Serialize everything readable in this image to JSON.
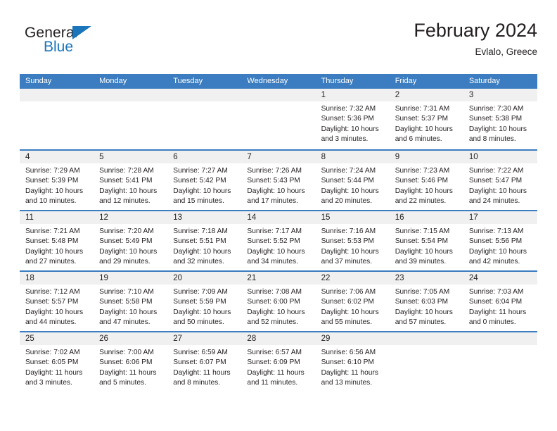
{
  "brand": {
    "general": "General",
    "blue": "Blue",
    "triangle_color": "#1b75bb"
  },
  "header": {
    "title": "February 2024",
    "subtitle": "Evlalo, Greece"
  },
  "theme": {
    "header_blue": "#3b7dc0",
    "daystrip_gray": "#f0f0f0",
    "text": "#231f20"
  },
  "weekdays": [
    "Sunday",
    "Monday",
    "Tuesday",
    "Wednesday",
    "Thursday",
    "Friday",
    "Saturday"
  ],
  "labels": {
    "sunrise": "Sunrise:",
    "sunset": "Sunset:",
    "daylight": "Daylight:"
  },
  "weeks": [
    [
      {
        "day": "",
        "empty": true
      },
      {
        "day": "",
        "empty": true
      },
      {
        "day": "",
        "empty": true
      },
      {
        "day": "",
        "empty": true
      },
      {
        "day": "1",
        "sunrise": "Sunrise: 7:32 AM",
        "sunset": "Sunset: 5:36 PM",
        "daylight1": "Daylight: 10 hours",
        "daylight2": "and 3 minutes."
      },
      {
        "day": "2",
        "sunrise": "Sunrise: 7:31 AM",
        "sunset": "Sunset: 5:37 PM",
        "daylight1": "Daylight: 10 hours",
        "daylight2": "and 6 minutes."
      },
      {
        "day": "3",
        "sunrise": "Sunrise: 7:30 AM",
        "sunset": "Sunset: 5:38 PM",
        "daylight1": "Daylight: 10 hours",
        "daylight2": "and 8 minutes."
      }
    ],
    [
      {
        "day": "4",
        "sunrise": "Sunrise: 7:29 AM",
        "sunset": "Sunset: 5:39 PM",
        "daylight1": "Daylight: 10 hours",
        "daylight2": "and 10 minutes."
      },
      {
        "day": "5",
        "sunrise": "Sunrise: 7:28 AM",
        "sunset": "Sunset: 5:41 PM",
        "daylight1": "Daylight: 10 hours",
        "daylight2": "and 12 minutes."
      },
      {
        "day": "6",
        "sunrise": "Sunrise: 7:27 AM",
        "sunset": "Sunset: 5:42 PM",
        "daylight1": "Daylight: 10 hours",
        "daylight2": "and 15 minutes."
      },
      {
        "day": "7",
        "sunrise": "Sunrise: 7:26 AM",
        "sunset": "Sunset: 5:43 PM",
        "daylight1": "Daylight: 10 hours",
        "daylight2": "and 17 minutes."
      },
      {
        "day": "8",
        "sunrise": "Sunrise: 7:24 AM",
        "sunset": "Sunset: 5:44 PM",
        "daylight1": "Daylight: 10 hours",
        "daylight2": "and 20 minutes."
      },
      {
        "day": "9",
        "sunrise": "Sunrise: 7:23 AM",
        "sunset": "Sunset: 5:46 PM",
        "daylight1": "Daylight: 10 hours",
        "daylight2": "and 22 minutes."
      },
      {
        "day": "10",
        "sunrise": "Sunrise: 7:22 AM",
        "sunset": "Sunset: 5:47 PM",
        "daylight1": "Daylight: 10 hours",
        "daylight2": "and 24 minutes."
      }
    ],
    [
      {
        "day": "11",
        "sunrise": "Sunrise: 7:21 AM",
        "sunset": "Sunset: 5:48 PM",
        "daylight1": "Daylight: 10 hours",
        "daylight2": "and 27 minutes."
      },
      {
        "day": "12",
        "sunrise": "Sunrise: 7:20 AM",
        "sunset": "Sunset: 5:49 PM",
        "daylight1": "Daylight: 10 hours",
        "daylight2": "and 29 minutes."
      },
      {
        "day": "13",
        "sunrise": "Sunrise: 7:18 AM",
        "sunset": "Sunset: 5:51 PM",
        "daylight1": "Daylight: 10 hours",
        "daylight2": "and 32 minutes."
      },
      {
        "day": "14",
        "sunrise": "Sunrise: 7:17 AM",
        "sunset": "Sunset: 5:52 PM",
        "daylight1": "Daylight: 10 hours",
        "daylight2": "and 34 minutes."
      },
      {
        "day": "15",
        "sunrise": "Sunrise: 7:16 AM",
        "sunset": "Sunset: 5:53 PM",
        "daylight1": "Daylight: 10 hours",
        "daylight2": "and 37 minutes."
      },
      {
        "day": "16",
        "sunrise": "Sunrise: 7:15 AM",
        "sunset": "Sunset: 5:54 PM",
        "daylight1": "Daylight: 10 hours",
        "daylight2": "and 39 minutes."
      },
      {
        "day": "17",
        "sunrise": "Sunrise: 7:13 AM",
        "sunset": "Sunset: 5:56 PM",
        "daylight1": "Daylight: 10 hours",
        "daylight2": "and 42 minutes."
      }
    ],
    [
      {
        "day": "18",
        "sunrise": "Sunrise: 7:12 AM",
        "sunset": "Sunset: 5:57 PM",
        "daylight1": "Daylight: 10 hours",
        "daylight2": "and 44 minutes."
      },
      {
        "day": "19",
        "sunrise": "Sunrise: 7:10 AM",
        "sunset": "Sunset: 5:58 PM",
        "daylight1": "Daylight: 10 hours",
        "daylight2": "and 47 minutes."
      },
      {
        "day": "20",
        "sunrise": "Sunrise: 7:09 AM",
        "sunset": "Sunset: 5:59 PM",
        "daylight1": "Daylight: 10 hours",
        "daylight2": "and 50 minutes."
      },
      {
        "day": "21",
        "sunrise": "Sunrise: 7:08 AM",
        "sunset": "Sunset: 6:00 PM",
        "daylight1": "Daylight: 10 hours",
        "daylight2": "and 52 minutes."
      },
      {
        "day": "22",
        "sunrise": "Sunrise: 7:06 AM",
        "sunset": "Sunset: 6:02 PM",
        "daylight1": "Daylight: 10 hours",
        "daylight2": "and 55 minutes."
      },
      {
        "day": "23",
        "sunrise": "Sunrise: 7:05 AM",
        "sunset": "Sunset: 6:03 PM",
        "daylight1": "Daylight: 10 hours",
        "daylight2": "and 57 minutes."
      },
      {
        "day": "24",
        "sunrise": "Sunrise: 7:03 AM",
        "sunset": "Sunset: 6:04 PM",
        "daylight1": "Daylight: 11 hours",
        "daylight2": "and 0 minutes."
      }
    ],
    [
      {
        "day": "25",
        "sunrise": "Sunrise: 7:02 AM",
        "sunset": "Sunset: 6:05 PM",
        "daylight1": "Daylight: 11 hours",
        "daylight2": "and 3 minutes."
      },
      {
        "day": "26",
        "sunrise": "Sunrise: 7:00 AM",
        "sunset": "Sunset: 6:06 PM",
        "daylight1": "Daylight: 11 hours",
        "daylight2": "and 5 minutes."
      },
      {
        "day": "27",
        "sunrise": "Sunrise: 6:59 AM",
        "sunset": "Sunset: 6:07 PM",
        "daylight1": "Daylight: 11 hours",
        "daylight2": "and 8 minutes."
      },
      {
        "day": "28",
        "sunrise": "Sunrise: 6:57 AM",
        "sunset": "Sunset: 6:09 PM",
        "daylight1": "Daylight: 11 hours",
        "daylight2": "and 11 minutes."
      },
      {
        "day": "29",
        "sunrise": "Sunrise: 6:56 AM",
        "sunset": "Sunset: 6:10 PM",
        "daylight1": "Daylight: 11 hours",
        "daylight2": "and 13 minutes."
      },
      {
        "day": "",
        "empty": true
      },
      {
        "day": "",
        "empty": true
      }
    ]
  ]
}
